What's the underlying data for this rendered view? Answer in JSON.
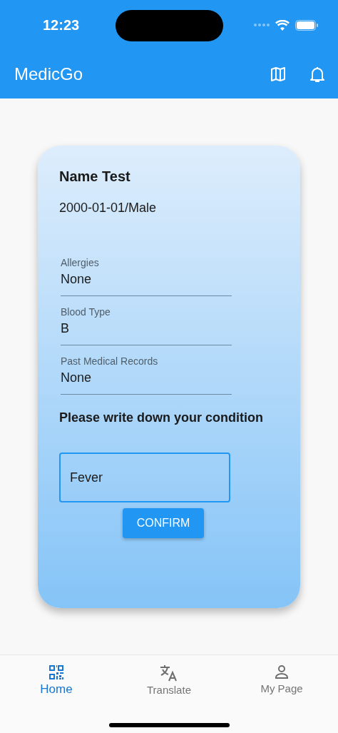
{
  "status_bar": {
    "time": "12:23"
  },
  "app_bar": {
    "title": "MedicGo"
  },
  "profile": {
    "name": "Name Test",
    "birth_gender": "2000-01-01/Male",
    "fields": [
      {
        "label": "Allergies",
        "value": "None"
      },
      {
        "label": "Blood Type",
        "value": "B"
      },
      {
        "label": "Past Medical Records",
        "value": "None"
      }
    ],
    "prompt": "Please write down your condition",
    "condition_input": {
      "value": "Fever"
    },
    "confirm_button": "CONFIRM"
  },
  "bottom_nav": [
    {
      "label": "Home",
      "selected": true
    },
    {
      "label": "Translate",
      "selected": false
    },
    {
      "label": "My Page",
      "selected": false
    }
  ]
}
